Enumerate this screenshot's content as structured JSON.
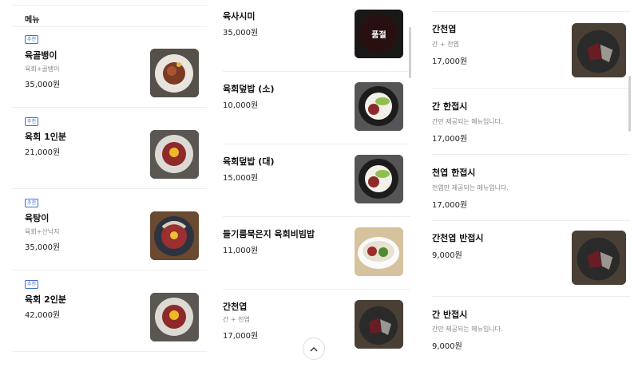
{
  "menu_header": "메뉴",
  "soldout_label": "품절",
  "top_button_icon": "chevron-up-icon",
  "col1": [
    {
      "badge": "추천",
      "name": "육골뱅이",
      "desc": "육회+골뱅이",
      "price": "35,000원"
    },
    {
      "badge": "추천",
      "name": "육회 1인분",
      "desc": "",
      "price": "21,000원"
    },
    {
      "badge": "추천",
      "name": "육탕이",
      "desc": "육회+산낙지",
      "price": "35,000원"
    },
    {
      "badge": "추천",
      "name": "육회 2인분",
      "desc": "",
      "price": "42,000원"
    }
  ],
  "col2": [
    {
      "name": "육사시미",
      "desc": "",
      "price": "35,000원"
    },
    {
      "name": "육회덮밥 (소)",
      "desc": "",
      "price": "10,000원"
    },
    {
      "name": "육회덮밥 (대)",
      "desc": "",
      "price": "15,000원"
    },
    {
      "name": "들기름묵은지 육회비빔밥",
      "desc": "",
      "price": "11,000원"
    },
    {
      "name": "간천엽",
      "desc": "간 + 천엽",
      "price": "17,000원"
    }
  ],
  "col3": [
    {
      "name": "간천엽",
      "desc": "간 + 천엽",
      "price": "17,000원"
    },
    {
      "name": "간 한접시",
      "desc": "간만 제공되는 메뉴입니다.",
      "price": "17,000원"
    },
    {
      "name": "천엽 한접시",
      "desc": "천엽만 제공되는 메뉴입니다.",
      "price": "17,000원"
    },
    {
      "name": "간천엽 반접시",
      "desc": "",
      "price": "9,000원"
    },
    {
      "name": "간 반접시",
      "desc": "간만 제공되는 메뉴입니다.",
      "price": "9,000원"
    }
  ]
}
